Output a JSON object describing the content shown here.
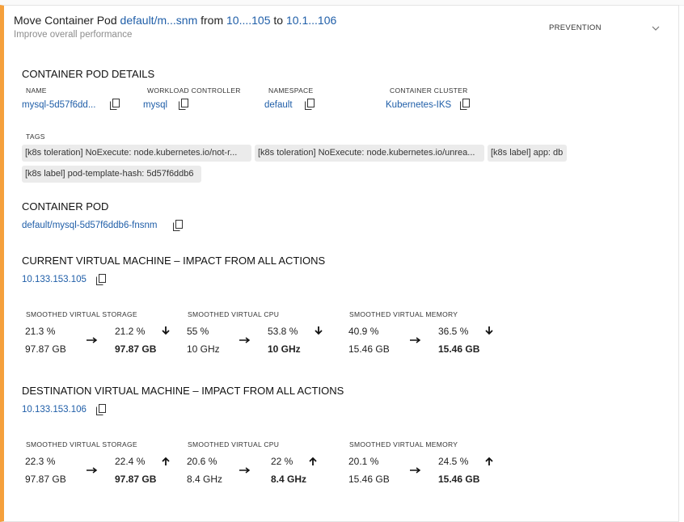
{
  "header": {
    "title_prefix": "Move Container Pod",
    "pod_link": "default/m...snm",
    "from_word": "from",
    "from_link": "10....105",
    "to_word": "to",
    "to_link": "10.1...106",
    "subtitle": "Improve overall performance",
    "mode": "PREVENTION",
    "accent_color": "#f5a03c"
  },
  "details": {
    "title": "CONTAINER POD DETAILS",
    "name_label": "NAME",
    "name_value": "mysql-5d57f6dd...",
    "workload_label": "WORKLOAD CONTROLLER",
    "workload_value": "mysql",
    "namespace_label": "NAMESPACE",
    "namespace_value": "default",
    "cluster_label": "CONTAINER CLUSTER",
    "cluster_value": "Kubernetes-IKS",
    "tags_label": "TAGS",
    "tags": [
      "[k8s toleration] NoExecute: node.kubernetes.io/not-r...",
      "[k8s toleration] NoExecute: node.kubernetes.io/unrea...",
      "[k8s label] app: db",
      "[k8s label] pod-template-hash: 5d57f6ddb6"
    ]
  },
  "pod": {
    "title": "CONTAINER POD",
    "value": "default/mysql-5d57f6ddb6-fnsnm"
  },
  "current_vm": {
    "title": "CURRENT VIRTUAL MACHINE – IMPACT FROM ALL ACTIONS",
    "ip": "10.133.153.105",
    "storage_label": "SMOOTHED VIRTUAL STORAGE",
    "storage_pct_before": "21.3 %",
    "storage_pct_after": "21.2 %",
    "storage_cap_before": "97.87 GB",
    "storage_cap_after": "97.87 GB",
    "storage_trend": "down",
    "cpu_label": "SMOOTHED VIRTUAL CPU",
    "cpu_pct_before": "55 %",
    "cpu_pct_after": "53.8 %",
    "cpu_cap_before": "10 GHz",
    "cpu_cap_after": "10 GHz",
    "cpu_trend": "down",
    "mem_label": "SMOOTHED VIRTUAL MEMORY",
    "mem_pct_before": "40.9 %",
    "mem_pct_after": "36.5 %",
    "mem_cap_before": "15.46 GB",
    "mem_cap_after": "15.46 GB",
    "mem_trend": "down"
  },
  "dest_vm": {
    "title": "DESTINATION VIRTUAL MACHINE – IMPACT FROM ALL ACTIONS",
    "ip": "10.133.153.106",
    "storage_label": "SMOOTHED VIRTUAL STORAGE",
    "storage_pct_before": "22.3 %",
    "storage_pct_after": "22.4 %",
    "storage_cap_before": "97.87 GB",
    "storage_cap_after": "97.87 GB",
    "storage_trend": "up",
    "cpu_label": "SMOOTHED VIRTUAL CPU",
    "cpu_pct_before": "20.6 %",
    "cpu_pct_after": "22 %",
    "cpu_cap_before": "8.4 GHz",
    "cpu_cap_after": "8.4 GHz",
    "cpu_trend": "up",
    "mem_label": "SMOOTHED VIRTUAL MEMORY",
    "mem_pct_before": "20.1 %",
    "mem_pct_after": "24.5 %",
    "mem_cap_before": "15.46 GB",
    "mem_cap_after": "15.46 GB",
    "mem_trend": "up"
  }
}
